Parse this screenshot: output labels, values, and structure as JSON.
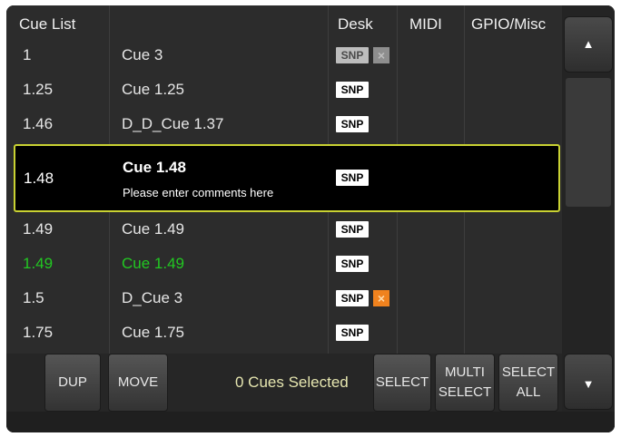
{
  "header": {
    "cue_list": "Cue List",
    "desk": "Desk",
    "midi": "MIDI",
    "gpio": "GPIO/Misc"
  },
  "rows": [
    {
      "num": "1",
      "name": "Cue 3",
      "snp": "SNP",
      "snp_dim": true,
      "x": "grey"
    },
    {
      "num": "1.25",
      "name": "Cue 1.25",
      "snp": "SNP"
    },
    {
      "num": "1.46",
      "name": "D_D_Cue 1.37",
      "snp": "SNP"
    },
    {
      "num": "1.49",
      "name": "Cue 1.49",
      "snp": "SNP"
    },
    {
      "num": "1.49",
      "name": "Cue 1.49",
      "snp": "SNP",
      "green": true
    },
    {
      "num": "1.5",
      "name": "D_Cue 3",
      "snp": "SNP",
      "x": "orange"
    },
    {
      "num": "1.75",
      "name": "Cue 1.75",
      "snp": "SNP"
    }
  ],
  "selected_row": {
    "num": "1.48",
    "name": "Cue 1.48",
    "comment": "Please enter comments here",
    "snp": "SNP"
  },
  "x_glyph": "×",
  "bottom": {
    "dup": "DUP",
    "move": "MOVE",
    "selected_count": "0 Cues Selected",
    "select": "SELECT",
    "multi_select": "MULTI\nSELECT",
    "select_all": "SELECT\nALL"
  },
  "scroll": {
    "up_icon": "▲",
    "down_icon": "▼"
  },
  "colors": {
    "selection_border": "#c9d232",
    "green_text": "#22c822",
    "orange_x": "#f0821e"
  }
}
